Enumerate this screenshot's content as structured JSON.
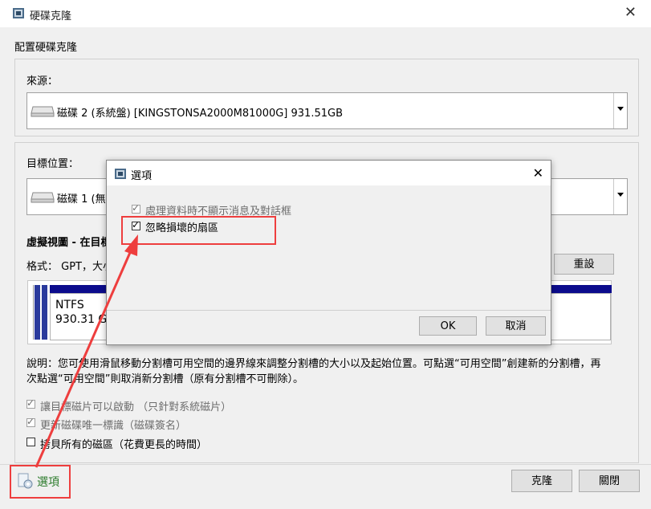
{
  "window": {
    "title": "硬碟克隆",
    "close_symbol": "✕"
  },
  "heading": "配置硬碟克隆",
  "source": {
    "label": "來源：",
    "disk_text": "磁碟 2 (系統盤) [KINGSTONSA2000M81000G]   931.51GB"
  },
  "target": {
    "label": "目標位置：",
    "disk_text": "磁碟 1 (無"
  },
  "virtual_view": {
    "title": "虛擬視圖 - 在目標",
    "format_text": "格式：  GPT，大小",
    "reset_button": "重設"
  },
  "partition": {
    "fs": "NTFS",
    "size": "930.31 G"
  },
  "description": {
    "line1": "說明：您可使用滑鼠移動分割槽可用空間的邊界線來調整分割槽的大小以及起始位置。可點選“可用空間”創建新的分割槽，再",
    "line2": "次點選“可用空間”則取消新分割槽（原有分割槽不可刪除）。"
  },
  "options": [
    {
      "label": "讓目標磁片可以啟動  （只針對系統磁片）",
      "checked": true,
      "disabled": true
    },
    {
      "label": "更新磁碟唯一標識（磁碟簽名）",
      "checked": true,
      "disabled": true
    },
    {
      "label": "拷貝所有的磁區（花費更長的時間）",
      "checked": false,
      "disabled": false
    }
  ],
  "footer": {
    "options_link": "選項",
    "clone_button": "克隆",
    "close_button": "關閉"
  },
  "dialog": {
    "title": "選項",
    "close_symbol": "✕",
    "opt_no_prompt": "處理資料時不顯示消息及對話框",
    "opt_ignore_bad": "忽略損壞的扇區",
    "ok": "OK",
    "cancel": "取消"
  },
  "annotation_color": "#ee3e3e"
}
